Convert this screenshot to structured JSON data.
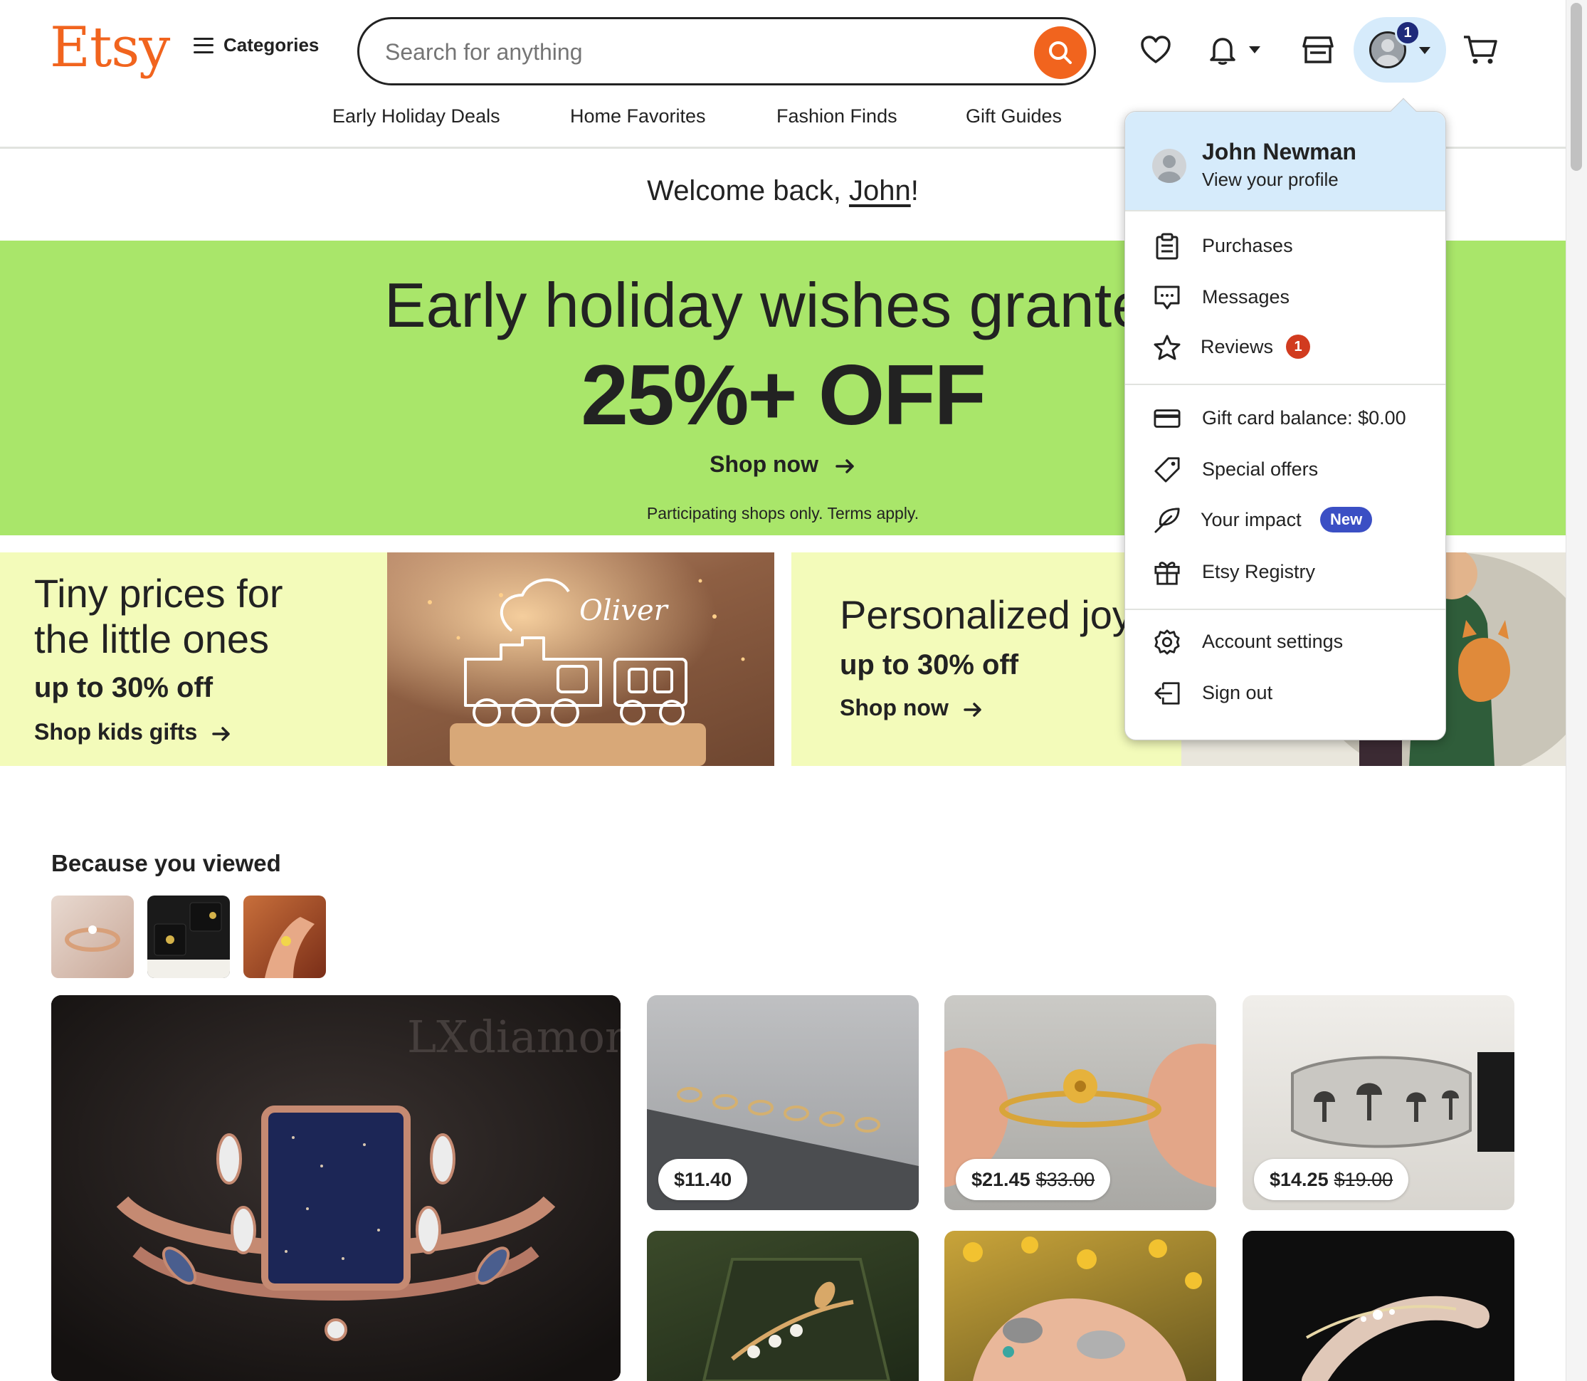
{
  "header": {
    "logo": "Etsy",
    "categories_label": "Categories",
    "search_placeholder": "Search for anything",
    "account_badge": "1"
  },
  "nav": {
    "links": [
      "Early Holiday Deals",
      "Home Favorites",
      "Fashion Finds",
      "Gift Guides"
    ]
  },
  "welcome": {
    "prefix": "Welcome back, ",
    "name": "John",
    "suffix": "!"
  },
  "hero": {
    "title": "Early holiday wishes granted",
    "discount": "25%+ OFF",
    "cta": "Shop now",
    "terms": "Participating shops only. Terms apply.",
    "background": "#A9E66A"
  },
  "promos": [
    {
      "title_line1": "Tiny prices for",
      "title_line2": "the little ones",
      "subtitle": "up to 30% off",
      "cta": "Shop kids gifts",
      "image_text": "Oliver"
    },
    {
      "title_line1": "Personalized joy",
      "subtitle": "up to 30% off",
      "cta": "Shop now"
    }
  ],
  "account_menu": {
    "name": "John Newman",
    "view_profile": "View your profile",
    "items": [
      {
        "label": "Purchases",
        "icon": "clipboard-icon"
      },
      {
        "label": "Messages",
        "icon": "message-icon"
      },
      {
        "label": "Reviews",
        "icon": "star-icon",
        "badge": "1"
      },
      {
        "label": "Gift card balance: $0.00",
        "icon": "credit-card-icon"
      },
      {
        "label": "Special offers",
        "icon": "tag-icon"
      },
      {
        "label": "Your impact",
        "icon": "leaf-icon",
        "badge": "New"
      },
      {
        "label": "Etsy Registry",
        "icon": "gift-icon"
      },
      {
        "label": "Account settings",
        "icon": "gear-icon"
      },
      {
        "label": "Sign out",
        "icon": "sign-out-icon"
      }
    ]
  },
  "because_you_viewed": {
    "title": "Because you viewed",
    "listings": [
      {
        "price": "$11.40"
      },
      {
        "price": "$21.45",
        "original_price": "$33.00"
      },
      {
        "price": "$14.25",
        "original_price": "$19.00"
      }
    ],
    "watermark": "LXdiamond"
  },
  "colors": {
    "brand": "#F1641E",
    "account_highlight": "#D6EBFB",
    "promo_bg": "#F3FBBA",
    "badge_red": "#D13B1F",
    "badge_new": "#3B4FC4"
  }
}
